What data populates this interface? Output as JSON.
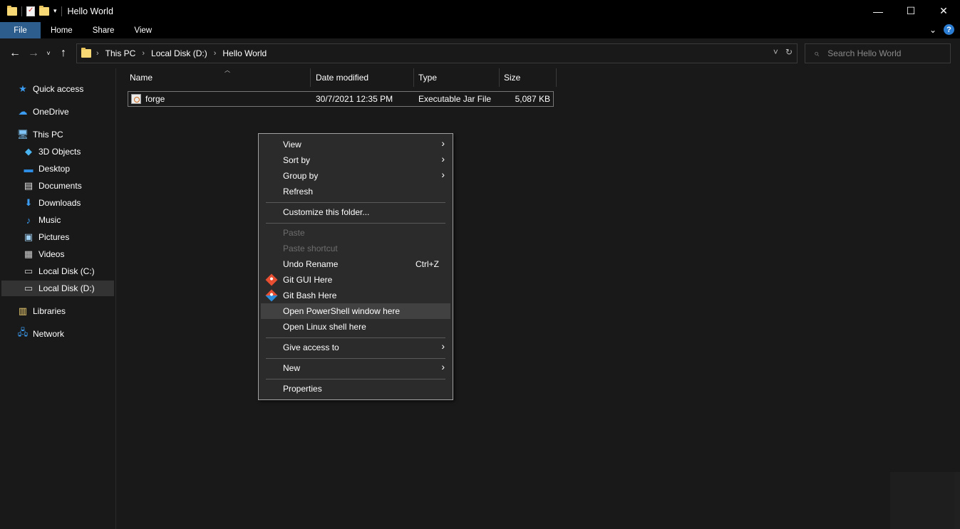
{
  "window": {
    "title": "Hello World",
    "controls": {
      "minimize": "—",
      "maximize": "☐",
      "close": "✕"
    }
  },
  "ribbon": {
    "tabs": [
      "File",
      "Home",
      "Share",
      "View"
    ],
    "help": "?"
  },
  "nav": {
    "back": "←",
    "forward": "→",
    "recent": "˅",
    "up": "↑"
  },
  "address": {
    "crumbs": [
      "This PC",
      "Local Disk (D:)",
      "Hello World"
    ],
    "separator": "›",
    "dropdown": "˅",
    "refresh": "↻"
  },
  "search": {
    "placeholder": "Search Hello World",
    "icon": "search-icon"
  },
  "sidebar": {
    "items": [
      {
        "label": "Quick access",
        "icon": "star-icon"
      },
      {
        "label": "OneDrive",
        "icon": "cloud-icon"
      },
      {
        "label": "This PC",
        "icon": "computer-icon"
      },
      {
        "label": "3D Objects",
        "icon": "cube-icon"
      },
      {
        "label": "Desktop",
        "icon": "desktop-icon"
      },
      {
        "label": "Documents",
        "icon": "document-icon"
      },
      {
        "label": "Downloads",
        "icon": "download-icon"
      },
      {
        "label": "Music",
        "icon": "music-icon"
      },
      {
        "label": "Pictures",
        "icon": "picture-icon"
      },
      {
        "label": "Videos",
        "icon": "video-icon"
      },
      {
        "label": "Local Disk (C:)",
        "icon": "drive-icon"
      },
      {
        "label": "Local Disk (D:)",
        "icon": "drive-icon"
      },
      {
        "label": "Libraries",
        "icon": "library-icon"
      },
      {
        "label": "Network",
        "icon": "network-icon"
      }
    ],
    "selected": "Local Disk (D:)"
  },
  "columns": [
    "Name",
    "Date modified",
    "Type",
    "Size"
  ],
  "files": [
    {
      "name": "forge",
      "date_modified": "30/7/2021 12:35 PM",
      "type": "Executable Jar File",
      "size": "5,087 KB"
    }
  ],
  "context_menu": {
    "items": [
      {
        "label": "View",
        "submenu": true
      },
      {
        "label": "Sort by",
        "submenu": true
      },
      {
        "label": "Group by",
        "submenu": true
      },
      {
        "label": "Refresh"
      },
      {
        "label": "Customize this folder..."
      },
      {
        "label": "Paste",
        "disabled": true
      },
      {
        "label": "Paste shortcut",
        "disabled": true
      },
      {
        "label": "Undo Rename",
        "shortcut": "Ctrl+Z"
      },
      {
        "label": "Git GUI Here",
        "icon": "git-gui-icon"
      },
      {
        "label": "Git Bash Here",
        "icon": "git-bash-icon"
      },
      {
        "label": "Open PowerShell window here",
        "highlighted": true
      },
      {
        "label": "Open Linux shell here"
      },
      {
        "label": "Give access to",
        "submenu": true
      },
      {
        "label": "New",
        "submenu": true
      },
      {
        "label": "Properties"
      }
    ],
    "submenu_arrow": "›"
  }
}
